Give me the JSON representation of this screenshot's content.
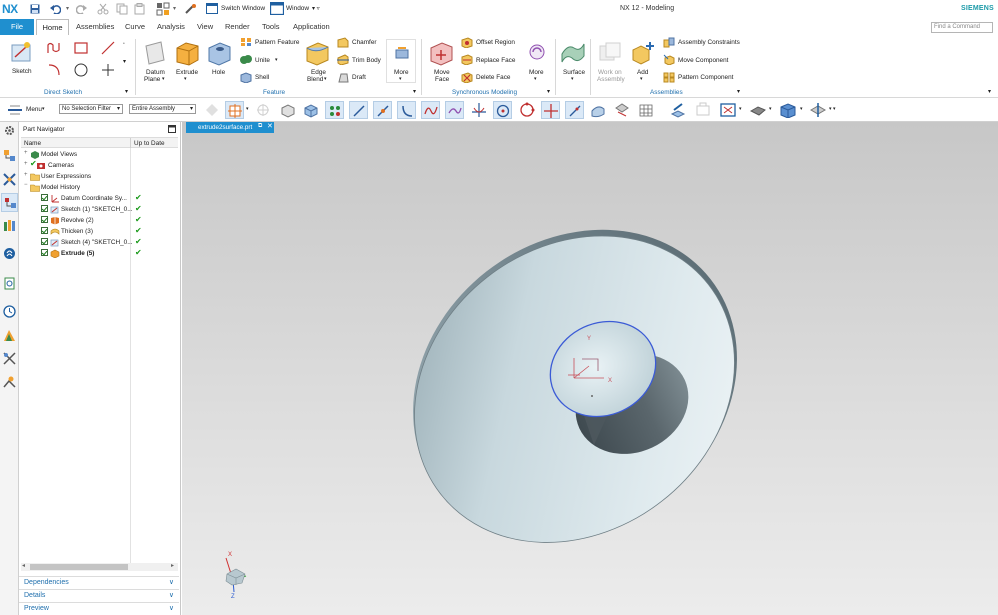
{
  "app": {
    "logo": "NX",
    "title": "NX 12 - Modeling",
    "vendor": "SIEMENS",
    "find_placeholder": "Find a Command"
  },
  "quick_access": {
    "switch_window": "Switch Window",
    "window": "Window"
  },
  "tabs": [
    "File",
    "Home",
    "Assemblies",
    "Curve",
    "Analysis",
    "View",
    "Render",
    "Tools",
    "Application"
  ],
  "ribbon": {
    "direct_sketch": {
      "sketch": "Sketch",
      "group": "Direct Sketch"
    },
    "feature": {
      "datum_plane": "Datum",
      "datum_plane2": "Plane",
      "extrude": "Extrude",
      "hole": "Hole",
      "pattern_feature": "Pattern Feature",
      "unite": "Unite",
      "shell": "Shell",
      "edge_blend": "Edge",
      "edge_blend2": "Blend",
      "chamfer": "Chamfer",
      "trim_body": "Trim Body",
      "draft": "Draft",
      "more": "More",
      "group": "Feature"
    },
    "synchronous": {
      "move_face": "Move",
      "move_face2": "Face",
      "offset_region": "Offset Region",
      "replace_face": "Replace Face",
      "delete_face": "Delete Face",
      "more": "More",
      "group": "Synchronous Modeling"
    },
    "surface": {
      "surface": "Surface"
    },
    "assemblies": {
      "work_on": "Work on",
      "work_on2": "Assembly",
      "add": "Add",
      "assembly_constraints": "Assembly Constraints",
      "move_component": "Move Component",
      "pattern_component": "Pattern Component",
      "group": "Assemblies"
    }
  },
  "selection": {
    "menu": "Menu",
    "filter": "No Selection Filter",
    "scope": "Entire Assembly"
  },
  "navigator": {
    "title": "Part Navigator",
    "col_name": "Name",
    "col_status": "Up to Date",
    "folders": [
      "Model Views",
      "Cameras",
      "User Expressions",
      "Model History"
    ],
    "features": [
      {
        "name": "Datum Coordinate Sy...",
        "ok": true
      },
      {
        "name": "Sketch (1) \"SKETCH_0...",
        "ok": true
      },
      {
        "name": "Revolve (2)",
        "ok": true
      },
      {
        "name": "Thicken (3)",
        "ok": true
      },
      {
        "name": "Sketch (4) \"SKETCH_0...",
        "ok": true
      },
      {
        "name": "Extrude (5)",
        "ok": true
      }
    ],
    "docks": [
      "Dependencies",
      "Details",
      "Preview"
    ]
  },
  "viewport": {
    "tab": "extrude2surface.prt",
    "triad": {
      "x": "X",
      "y": "Y",
      "z": "Z"
    }
  },
  "colors": {
    "accent": "#1f8fcf",
    "group_label": "#1f6fad",
    "edge_highlight": "#3b5bd6",
    "ok_green": "#1a9a1a"
  }
}
